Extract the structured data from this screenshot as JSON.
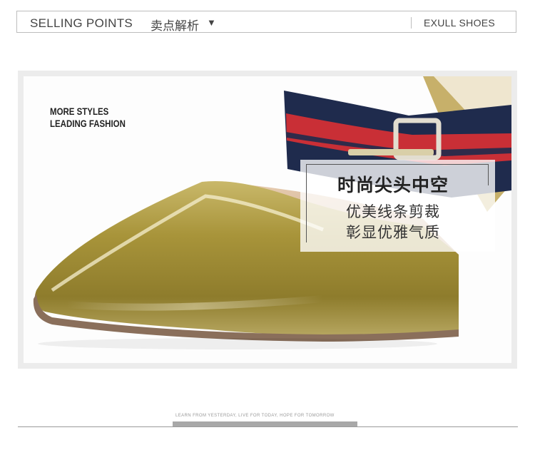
{
  "header": {
    "title_en": "SELLING POINTS",
    "title_cn": "卖点解析",
    "arrow": "▼",
    "brand": "EXULL SHOES"
  },
  "photo": {
    "subject": "pointed-toe patent leather mule with striped strap",
    "tagline_line1": "MORE STYLES",
    "tagline_line2": "LEADING FASHION",
    "caption_title": "时尚尖头中空",
    "caption_line1": "优美线条剪裁",
    "caption_line2": "彰显优雅气质",
    "colors": {
      "patent": "#a89436",
      "strap_navy": "#1f2b4d",
      "strap_red": "#c92f36",
      "buckle": "#d8d2c4",
      "sole": "#8a6f5b"
    }
  },
  "footer": {
    "slogan": "LEARN FROM YESTERDAY, LIVE FOR TODAY, HOPE FOR TOMORROW"
  }
}
